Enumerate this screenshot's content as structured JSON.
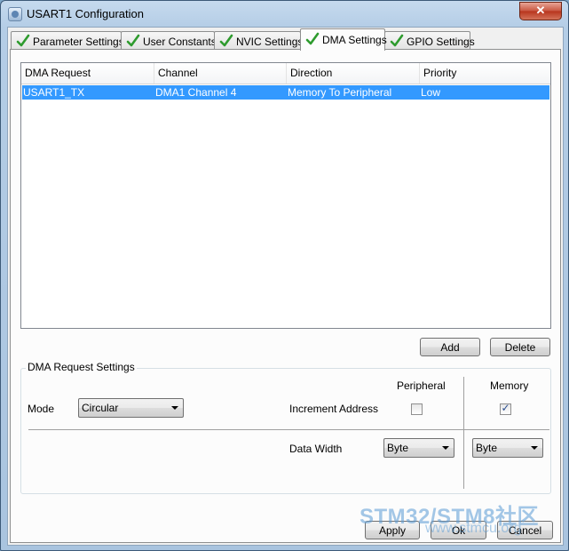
{
  "window": {
    "title": "USART1 Configuration",
    "close_glyph": "✕"
  },
  "tabs": [
    {
      "label": "Parameter Settings",
      "icon": "check-icon"
    },
    {
      "label": "User Constants",
      "icon": "check-icon"
    },
    {
      "label": "NVIC Settings",
      "icon": "check-icon"
    },
    {
      "label": "DMA Settings",
      "icon": "check-icon",
      "active": true
    },
    {
      "label": "GPIO Settings",
      "icon": "check-icon"
    }
  ],
  "dma_table": {
    "columns": [
      "DMA Request",
      "Channel",
      "Direction",
      "Priority"
    ],
    "rows": [
      {
        "request": "USART1_TX",
        "channel": "DMA1 Channel 4",
        "direction": "Memory To Peripheral",
        "priority": "Low"
      }
    ]
  },
  "buttons": {
    "add": "Add",
    "delete": "Delete",
    "apply": "Apply",
    "ok": "Ok",
    "cancel": "Cancel"
  },
  "request_settings": {
    "legend": "DMA Request Settings",
    "peripheral_header": "Peripheral",
    "memory_header": "Memory",
    "mode_label": "Mode",
    "mode_value": "Circular",
    "increment_label": "Increment Address",
    "peripheral_increment": false,
    "memory_increment": true,
    "data_width_label": "Data Width",
    "peripheral_width": "Byte",
    "memory_width": "Byte"
  },
  "watermark": {
    "main": "STM32/STM8社区",
    "sub": "www.stmcu.org"
  },
  "colors": {
    "selection": "#3399ff",
    "check_green": "#2e9b2e"
  }
}
